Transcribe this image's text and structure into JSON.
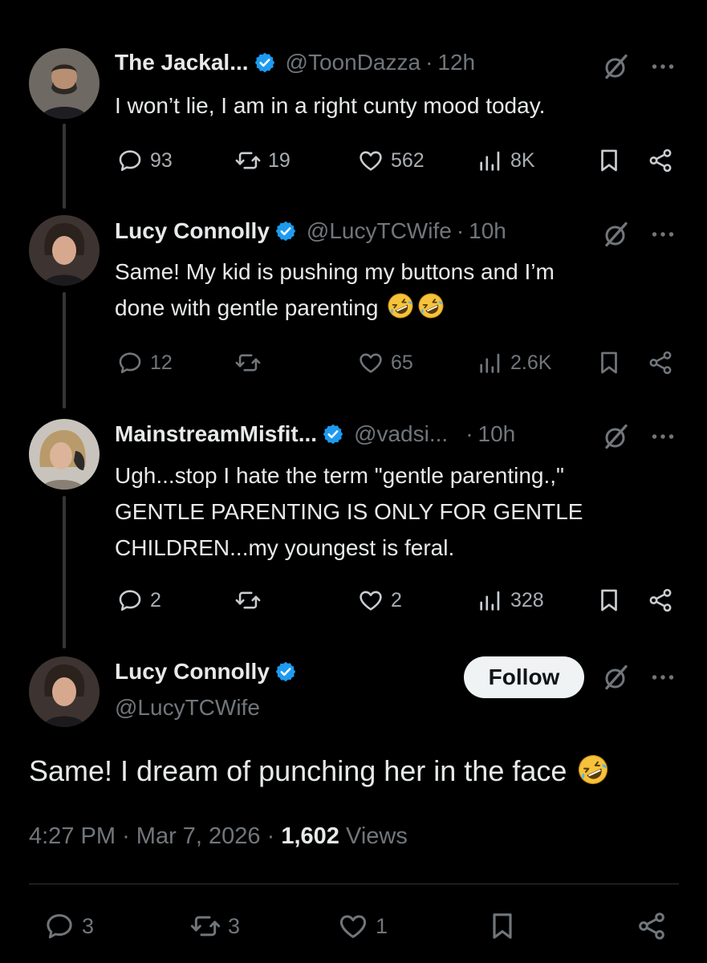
{
  "colors": {
    "background": "#000000",
    "text": "#e7e9ea",
    "muted": "#71767b",
    "verified": "#1d9bf0",
    "divider": "#2f3336",
    "follow_bg": "#eff3f4"
  },
  "replies": [
    {
      "name": "The Jackal...",
      "handle": "@ToonDazza",
      "sep": "·",
      "time": "12h",
      "lines": [
        "I won’t lie, I am in a right cunty mood today."
      ],
      "stats": {
        "replies": "93",
        "reposts": "19",
        "likes": "562",
        "views": "8K"
      }
    },
    {
      "name": "Lucy Connolly",
      "handle": "@LucyTCWife",
      "sep": "·",
      "time": "10h",
      "lines": [
        "Same! My kid is pushing my buttons and I’m",
        "done with gentle parenting"
      ],
      "emoji": "rolling-on-floor-laughing",
      "stats": {
        "replies": "12",
        "reposts": "",
        "likes": "65",
        "views": "2.6K"
      }
    },
    {
      "name": "MainstreamMisfit...",
      "handle": "@vadsi...",
      "sep": "·",
      "time": "10h",
      "lines": [
        "Ugh...stop I hate the term \"gentle parenting.,\"",
        "GENTLE PARENTING IS ONLY FOR GENTLE",
        "CHILDREN...my youngest is feral."
      ],
      "stats": {
        "replies": "2",
        "reposts": "",
        "likes": "2",
        "views": "328"
      }
    }
  ],
  "main": {
    "name": "Lucy Connolly",
    "handle": "@LucyTCWife",
    "follow_label": "Follow",
    "text": "Same! I dream of punching her in the face",
    "emoji": "rolling-on-floor-laughing",
    "time": "4:27 PM",
    "sep": "·",
    "date": "Mar 7, 2026",
    "views_count": "1,602",
    "views_label": "Views",
    "stats": {
      "replies": "3",
      "reposts": "3",
      "likes": "1"
    }
  }
}
